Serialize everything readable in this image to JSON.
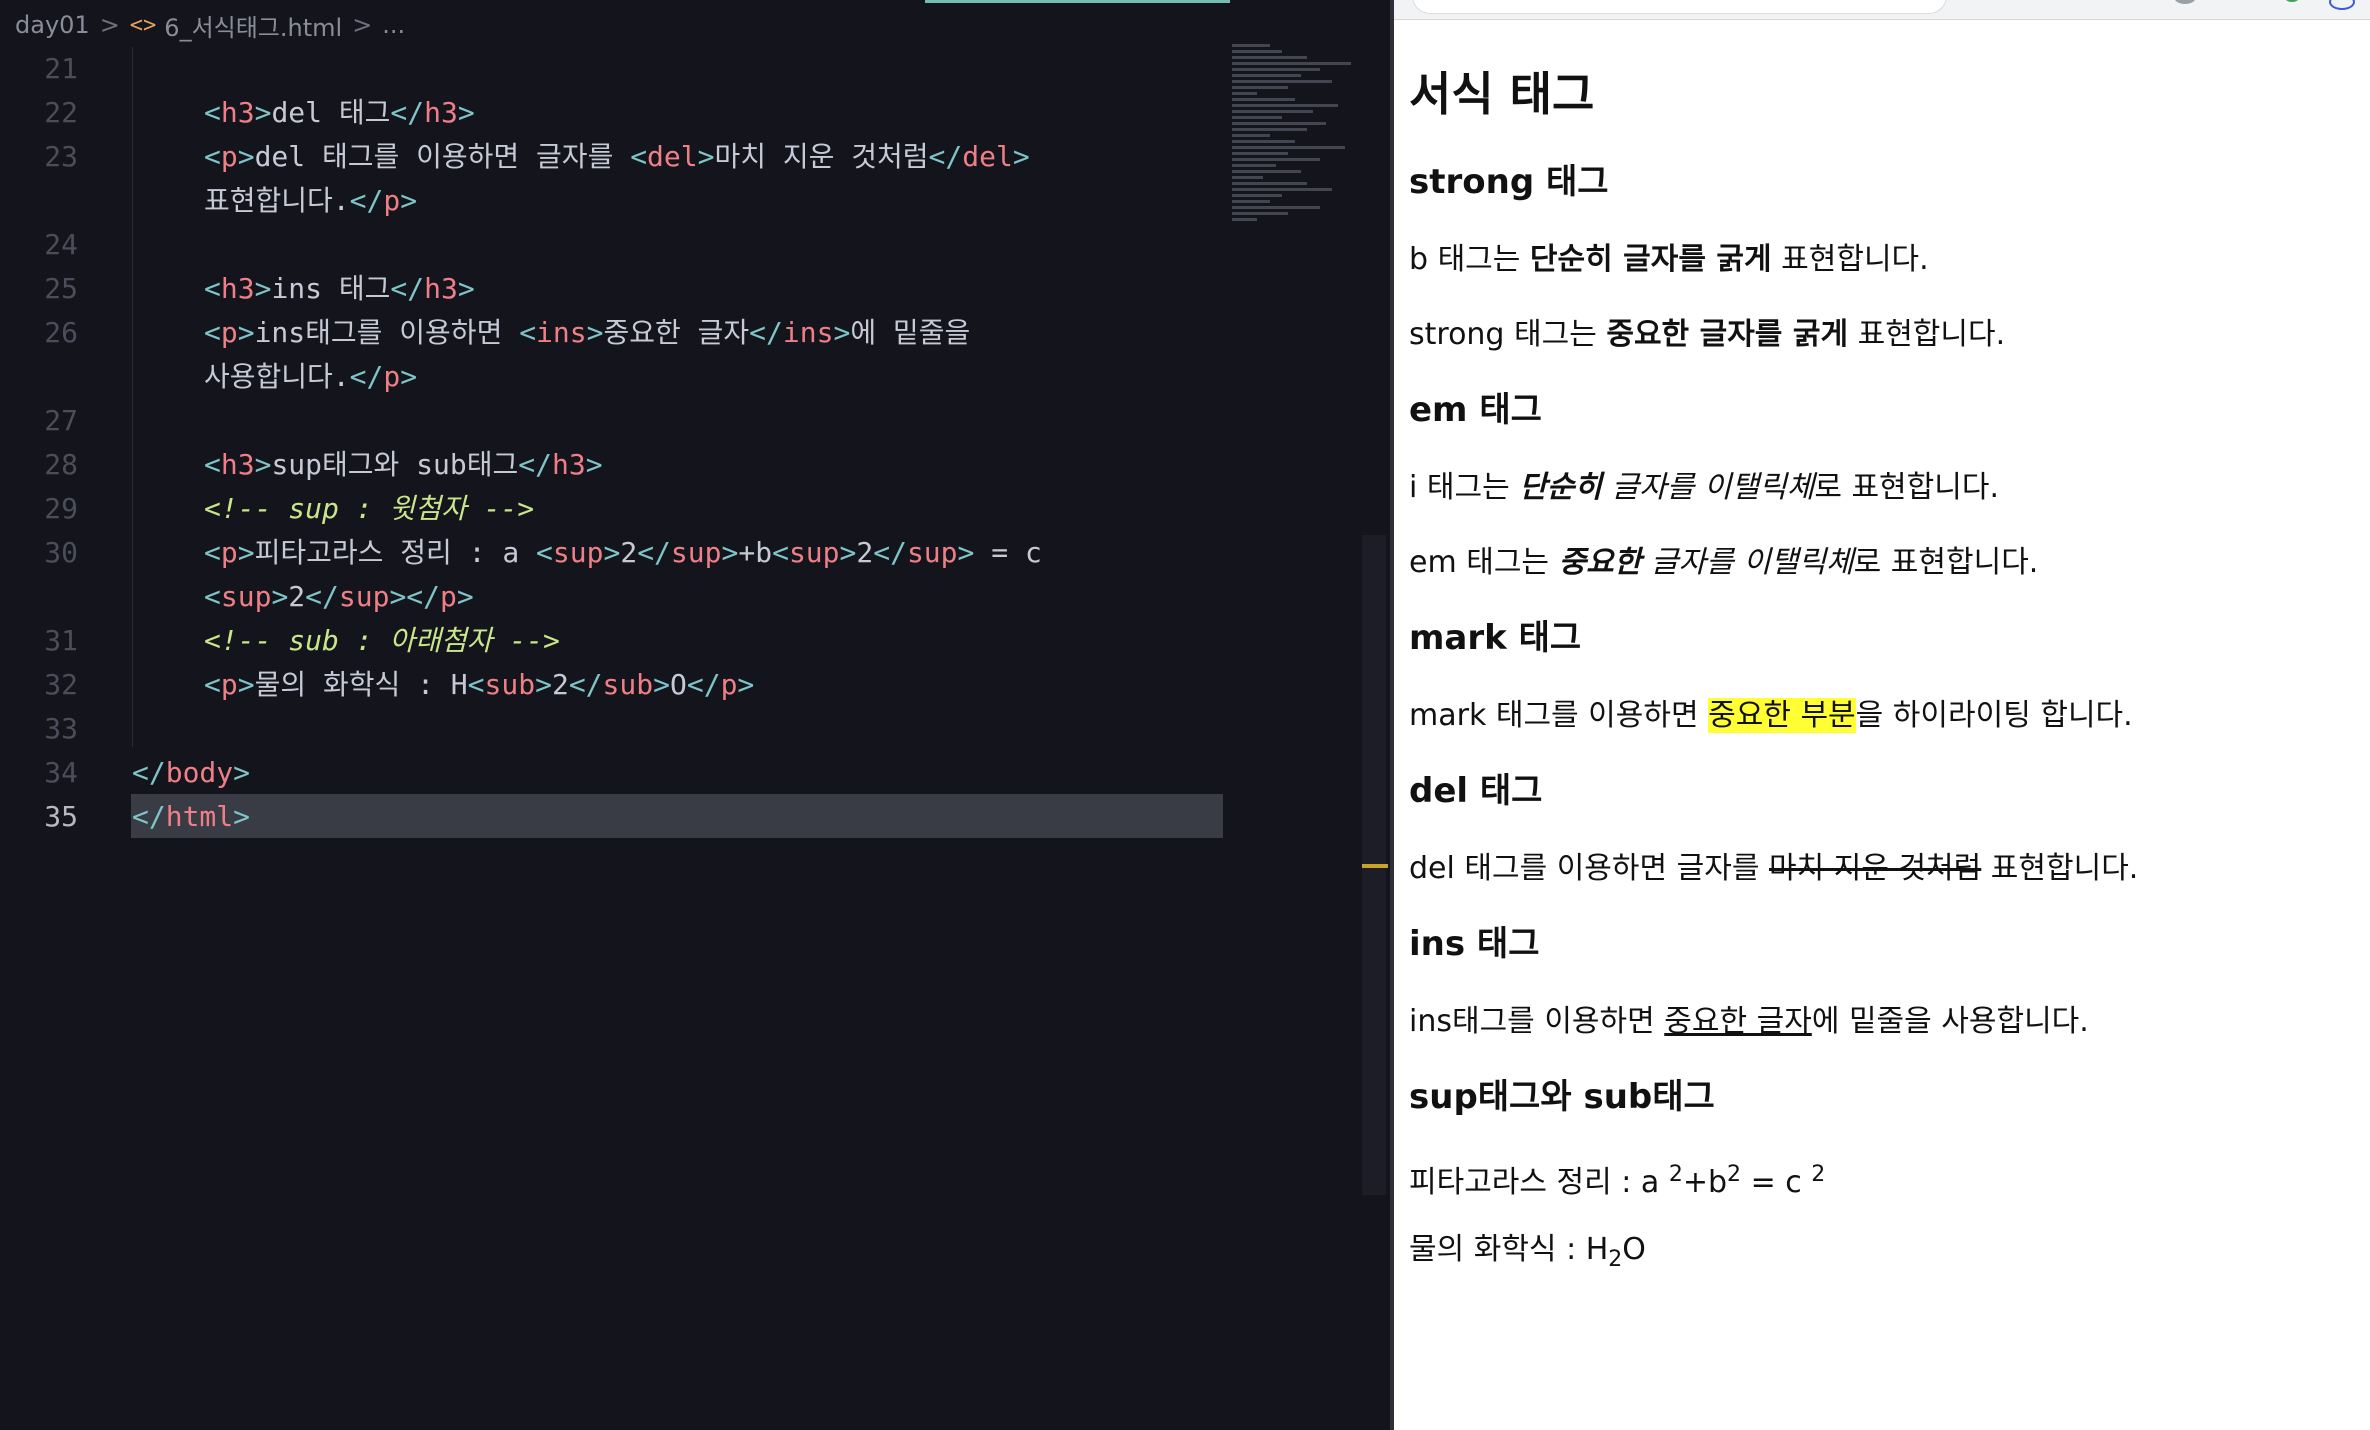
{
  "editor": {
    "breadcrumb": {
      "folder": "day01",
      "file_icon": "<>",
      "file": "6_서식태그.html",
      "more": "..."
    },
    "lines": [
      {
        "n": "21",
        "tokens": []
      },
      {
        "n": "22",
        "tokens": [
          [
            "br",
            "<"
          ],
          [
            "tag",
            "h3"
          ],
          [
            "br",
            ">"
          ],
          [
            "t",
            "del 태그"
          ],
          [
            "br",
            "</"
          ],
          [
            "tag",
            "h3"
          ],
          [
            "br",
            ">"
          ]
        ]
      },
      {
        "n": "23",
        "tokens": [
          [
            "br",
            "<"
          ],
          [
            "tag",
            "p"
          ],
          [
            "br",
            ">"
          ],
          [
            "t",
            "del 태그를 이용하면 글자를 "
          ],
          [
            "br",
            "<"
          ],
          [
            "tag",
            "del"
          ],
          [
            "br",
            ">"
          ],
          [
            "t",
            "마치 지운 것처럼"
          ],
          [
            "br",
            "</"
          ],
          [
            "tag",
            "del"
          ],
          [
            "br",
            ">"
          ]
        ]
      },
      {
        "n": "",
        "tokens": [
          [
            "t",
            "표현합니다."
          ],
          [
            "br",
            "</"
          ],
          [
            "tag",
            "p"
          ],
          [
            "br",
            ">"
          ]
        ]
      },
      {
        "n": "24",
        "tokens": []
      },
      {
        "n": "25",
        "tokens": [
          [
            "br",
            "<"
          ],
          [
            "tag",
            "h3"
          ],
          [
            "br",
            ">"
          ],
          [
            "t",
            "ins 태그"
          ],
          [
            "br",
            "</"
          ],
          [
            "tag",
            "h3"
          ],
          [
            "br",
            ">"
          ]
        ]
      },
      {
        "n": "26",
        "tokens": [
          [
            "br",
            "<"
          ],
          [
            "tag",
            "p"
          ],
          [
            "br",
            ">"
          ],
          [
            "t",
            "ins태그를 이용하면 "
          ],
          [
            "br",
            "<"
          ],
          [
            "tag",
            "ins"
          ],
          [
            "br",
            ">"
          ],
          [
            "t",
            "중요한 글자"
          ],
          [
            "br",
            "</"
          ],
          [
            "tag",
            "ins"
          ],
          [
            "br",
            ">"
          ],
          [
            "t",
            "에 밑줄을"
          ]
        ]
      },
      {
        "n": "",
        "tokens": [
          [
            "t",
            "사용합니다."
          ],
          [
            "br",
            "</"
          ],
          [
            "tag",
            "p"
          ],
          [
            "br",
            ">"
          ]
        ]
      },
      {
        "n": "27",
        "tokens": []
      },
      {
        "n": "28",
        "tokens": [
          [
            "br",
            "<"
          ],
          [
            "tag",
            "h3"
          ],
          [
            "br",
            ">"
          ],
          [
            "t",
            "sup태그와 sub태그"
          ],
          [
            "br",
            "</"
          ],
          [
            "tag",
            "h3"
          ],
          [
            "br",
            ">"
          ]
        ]
      },
      {
        "n": "29",
        "tokens": [
          [
            "cmt",
            "<!-- sup : 윗첨자 -->"
          ]
        ]
      },
      {
        "n": "30",
        "tokens": [
          [
            "br",
            "<"
          ],
          [
            "tag",
            "p"
          ],
          [
            "br",
            ">"
          ],
          [
            "t",
            "피타고라스 정리 : a "
          ],
          [
            "br",
            "<"
          ],
          [
            "tag",
            "sup"
          ],
          [
            "br",
            ">"
          ],
          [
            "t",
            "2"
          ],
          [
            "br",
            "</"
          ],
          [
            "tag",
            "sup"
          ],
          [
            "br",
            ">"
          ],
          [
            "t",
            "+b"
          ],
          [
            "br",
            "<"
          ],
          [
            "tag",
            "sup"
          ],
          [
            "br",
            ">"
          ],
          [
            "t",
            "2"
          ],
          [
            "br",
            "</"
          ],
          [
            "tag",
            "sup"
          ],
          [
            "br",
            ">"
          ],
          [
            "t",
            " = c"
          ]
        ]
      },
      {
        "n": "",
        "tokens": [
          [
            "br",
            "<"
          ],
          [
            "tag",
            "sup"
          ],
          [
            "br",
            ">"
          ],
          [
            "t",
            "2"
          ],
          [
            "br",
            "</"
          ],
          [
            "tag",
            "sup"
          ],
          [
            "br",
            "></"
          ],
          [
            "tag",
            "p"
          ],
          [
            "br",
            ">"
          ]
        ]
      },
      {
        "n": "31",
        "tokens": [
          [
            "cmt",
            "<!-- sub : 아래첨자 -->"
          ]
        ]
      },
      {
        "n": "32",
        "tokens": [
          [
            "br",
            "<"
          ],
          [
            "tag",
            "p"
          ],
          [
            "br",
            ">"
          ],
          [
            "t",
            "물의 화학식 : H"
          ],
          [
            "br",
            "<"
          ],
          [
            "tag",
            "sub"
          ],
          [
            "br",
            ">"
          ],
          [
            "t",
            "2"
          ],
          [
            "br",
            "</"
          ],
          [
            "tag",
            "sub"
          ],
          [
            "br",
            ">"
          ],
          [
            "t",
            "O"
          ],
          [
            "br",
            "</"
          ],
          [
            "tag",
            "p"
          ],
          [
            "br",
            ">"
          ]
        ]
      },
      {
        "n": "33",
        "tokens": []
      },
      {
        "n": "34",
        "outer": true,
        "tokens": [
          [
            "br",
            "</"
          ],
          [
            "tag",
            "body"
          ],
          [
            "br",
            ">"
          ]
        ]
      },
      {
        "n": "35",
        "outer": true,
        "active": true,
        "tokens": [
          [
            "br",
            "</"
          ],
          [
            "tag",
            "html"
          ],
          [
            "br",
            ">"
          ]
        ]
      }
    ]
  },
  "browser": {
    "h1": "서식 태그",
    "strong_h": "strong 태그",
    "b_p": {
      "pre": "b 태그는 ",
      "bold": "단순히 글자를 굵게",
      "post": " 표현합니다."
    },
    "strong_p": {
      "pre": "strong 태그는 ",
      "bold": "중요한 글자를 굵게",
      "post": " 표현합니다."
    },
    "em_h": "em 태그",
    "i_p": {
      "pre": "i 태그는 ",
      "bolditalic": "단순히",
      "italic": " 글자를 이탤릭체",
      "post": "로 표현합니다."
    },
    "em_p": {
      "pre": "em 태그는 ",
      "bolditalic": "중요한",
      "italic": " 글자를 이탤릭체",
      "post": "로 표현합니다."
    },
    "mark_h": "mark 태그",
    "mark_p": {
      "pre": "mark 태그를 이용하면 ",
      "mark": "중요한 부분",
      "post": "을 하이라이팅 합니다."
    },
    "del_h": "del 태그",
    "del_p": {
      "pre": "del 태그를 이용하면 글자를 ",
      "del": "마치 지운 것처럼",
      "post": " 표현합니다."
    },
    "ins_h": "ins 태그",
    "ins_p": {
      "pre": "ins태그를 이용하면 ",
      "ins": "중요한 글자",
      "post": "에 밑줄을 사용합니다."
    },
    "sup_h": "sup태그와 sub태그",
    "sup_p": {
      "pre": "피타고라스 정리 : a ",
      "sup1": "2",
      "mid": "+b",
      "sup2": "2",
      "mid2": " = c ",
      "sup3": "2"
    },
    "sub_p": {
      "pre": "물의 화학식 : H",
      "sub": "2",
      "post": "O"
    }
  }
}
